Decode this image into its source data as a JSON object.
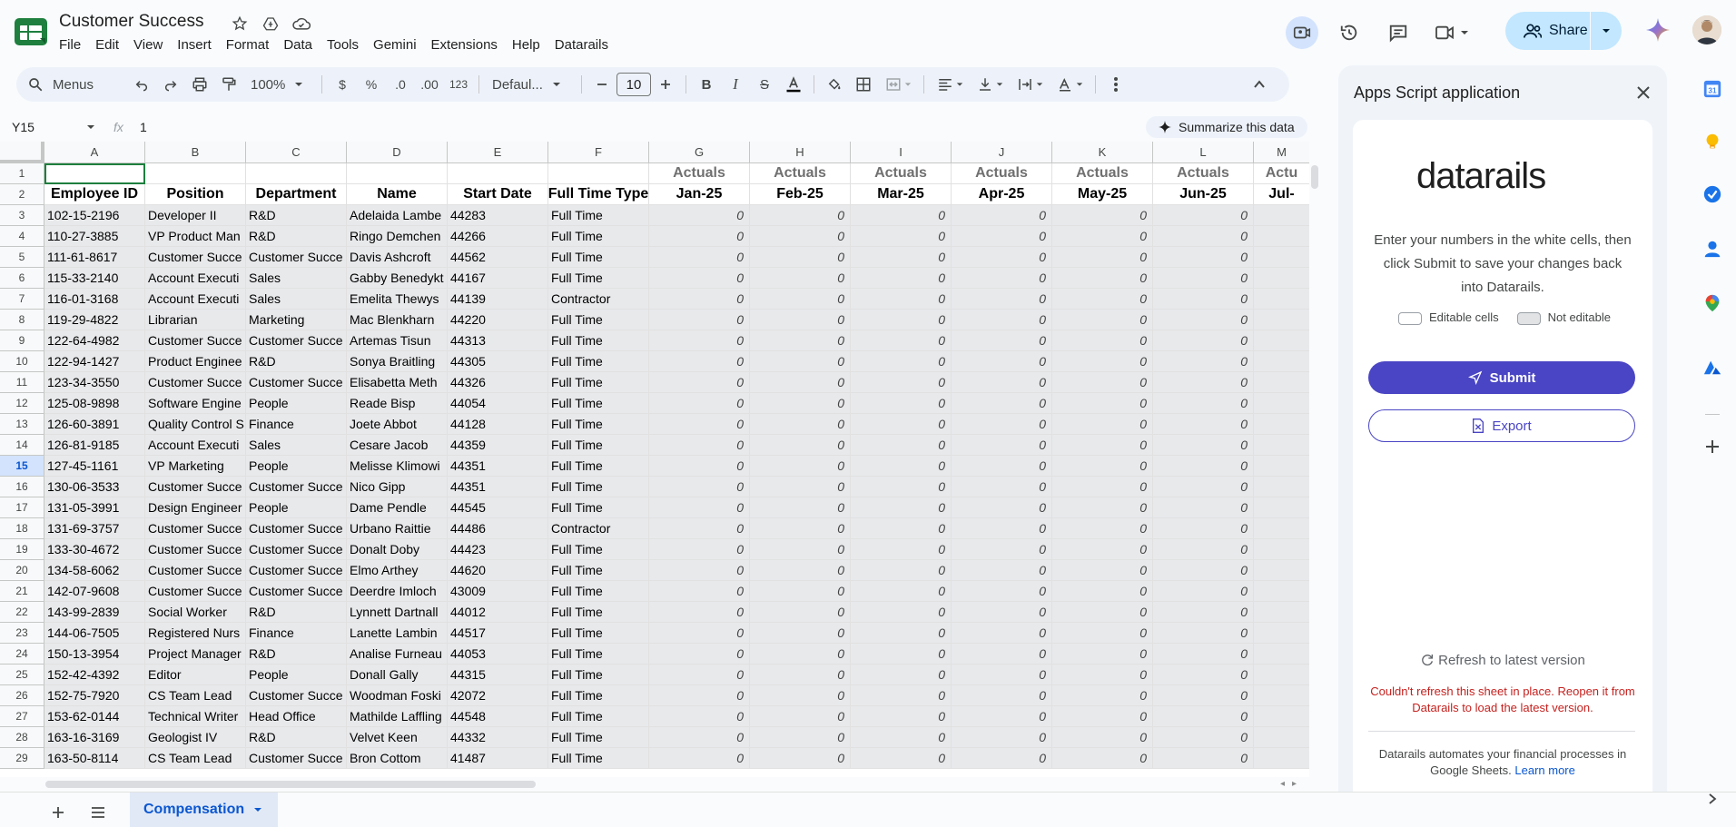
{
  "doc": {
    "title": "Customer Success",
    "menus": [
      "File",
      "Edit",
      "View",
      "Insert",
      "Format",
      "Data",
      "Tools",
      "Gemini",
      "Extensions",
      "Help",
      "Datarails"
    ]
  },
  "share": {
    "label": "Share"
  },
  "toolbar": {
    "search_label": "Menus",
    "zoom": "100%",
    "currency": "$",
    "percent": "%",
    "dec_decrease": ".0",
    "dec_increase": ".00",
    "number_format": "123",
    "font": "Defaul...",
    "font_size": "10"
  },
  "formula_bar": {
    "cell_ref": "Y15",
    "fx": "fx",
    "value": "1",
    "summarize_label": "Summarize this data"
  },
  "sheet": {
    "columns": [
      "A",
      "B",
      "C",
      "D",
      "E",
      "F",
      "G",
      "H",
      "I",
      "J",
      "K",
      "L",
      "M"
    ],
    "actuals_label": "Actuals",
    "months": [
      "Jan-25",
      "Feb-25",
      "Mar-25",
      "Apr-25",
      "May-25",
      "Jun-25",
      "Jul-"
    ],
    "actuals_last": "Actu",
    "headers": [
      "Employee ID",
      "Position",
      "Department",
      "Name",
      "Start Date",
      "Full Time Type"
    ],
    "rows": [
      [
        "102-15-2196",
        "Developer II",
        "R&D",
        "Adelaida Lambe",
        "44283",
        "Full Time"
      ],
      [
        "110-27-3885",
        "VP Product Man",
        "R&D",
        "Ringo Demchen",
        "44266",
        "Full Time"
      ],
      [
        "111-61-8617",
        "Customer Succe",
        "Customer Succe",
        "Davis Ashcroft",
        "44562",
        "Full Time"
      ],
      [
        "115-33-2140",
        "Account Executi",
        "Sales",
        "Gabby Benedykt",
        "44167",
        "Full Time"
      ],
      [
        "116-01-3168",
        "Account Executi",
        "Sales",
        "Emelita Thewys",
        "44139",
        "Contractor"
      ],
      [
        "119-29-4822",
        "Librarian",
        "Marketing",
        "Mac Blenkharn",
        "44220",
        "Full Time"
      ],
      [
        "122-64-4982",
        "Customer Succe",
        "Customer Succe",
        "Artemas Tisun",
        "44313",
        "Full Time"
      ],
      [
        "122-94-1427",
        "Product Enginee",
        "R&D",
        "Sonya Braitling",
        "44305",
        "Full Time"
      ],
      [
        "123-34-3550",
        "Customer Succe",
        "Customer Succe",
        "Elisabetta Meth",
        "44326",
        "Full Time"
      ],
      [
        "125-08-9898",
        "Software Engine",
        "People",
        "Reade Bisp",
        "44054",
        "Full Time"
      ],
      [
        "126-60-3891",
        "Quality Control S",
        "Finance",
        "Joete Abbot",
        "44128",
        "Full Time"
      ],
      [
        "126-81-9185",
        "Account Executi",
        "Sales",
        "Cesare Jacob",
        "44359",
        "Full Time"
      ],
      [
        "127-45-1161",
        "VP Marketing",
        "People",
        "Melisse Klimowi",
        "44351",
        "Full Time"
      ],
      [
        "130-06-3533",
        "Customer Succe",
        "Customer Succe",
        "Nico Gipp",
        "44351",
        "Full Time"
      ],
      [
        "131-05-3991",
        "Design Engineer",
        "People",
        "Dame Pendle",
        "44545",
        "Full Time"
      ],
      [
        "131-69-3757",
        "Customer Succe",
        "Customer Succe",
        "Urbano Raittie",
        "44486",
        "Contractor"
      ],
      [
        "133-30-4672",
        "Customer Succe",
        "Customer Succe",
        "Donalt Doby",
        "44423",
        "Full Time"
      ],
      [
        "134-58-6062",
        "Customer Succe",
        "Customer Succe",
        "Elmo Arthey",
        "44620",
        "Full Time"
      ],
      [
        "142-07-9608",
        "Customer Succe",
        "Customer Succe",
        "Deerdre Imloch",
        "43009",
        "Full Time"
      ],
      [
        "143-99-2839",
        "Social Worker",
        "R&D",
        "Lynnett Dartnall",
        "44012",
        "Full Time"
      ],
      [
        "144-06-7505",
        "Registered Nurs",
        "Finance",
        "Lanette Lambin",
        "44517",
        "Full Time"
      ],
      [
        "150-13-3954",
        "Project Manager",
        "R&D",
        "Analise Furneau",
        "44053",
        "Full Time"
      ],
      [
        "152-42-4392",
        "Editor",
        "People",
        "Donall Gally",
        "44315",
        "Full Time"
      ],
      [
        "152-75-7920",
        "CS Team Lead",
        "Customer Succe",
        "Woodman Foski",
        "42072",
        "Full Time"
      ],
      [
        "153-62-0144",
        "Technical Writer",
        "Head Office",
        "Mathilde Laffling",
        "44548",
        "Full Time"
      ],
      [
        "163-16-3169",
        "Geologist IV",
        "R&D",
        "Velvet Keen",
        "44332",
        "Full Time"
      ],
      [
        "163-50-8114",
        "CS Team Lead",
        "Customer Succe",
        "Bron Cottom",
        "41487",
        "Full Time"
      ]
    ],
    "zero": "0",
    "selected_row": "15"
  },
  "sheet_tab": {
    "label": "Compensation"
  },
  "panel": {
    "title": "Apps Script application",
    "logo_text": "datarails",
    "instructions": "Enter your numbers in the white cells, then click Submit to save your changes back into Datarails.",
    "legend_editable": "Editable cells",
    "legend_not_editable": "Not editable",
    "submit": "Submit",
    "export": "Export",
    "refresh": "Refresh to latest version",
    "error": "Couldn't refresh this sheet in place. Reopen it from Datarails to load the latest version.",
    "footer": "Datarails automates your financial processes in Google Sheets.",
    "learn_more": "Learn more"
  },
  "colors": {
    "accent": "#4a45c4",
    "sheets_green": "#1e7f3e",
    "share_bg": "#c2e7ff",
    "error": "#c5221f",
    "data_cell": "#e8e9eb"
  }
}
